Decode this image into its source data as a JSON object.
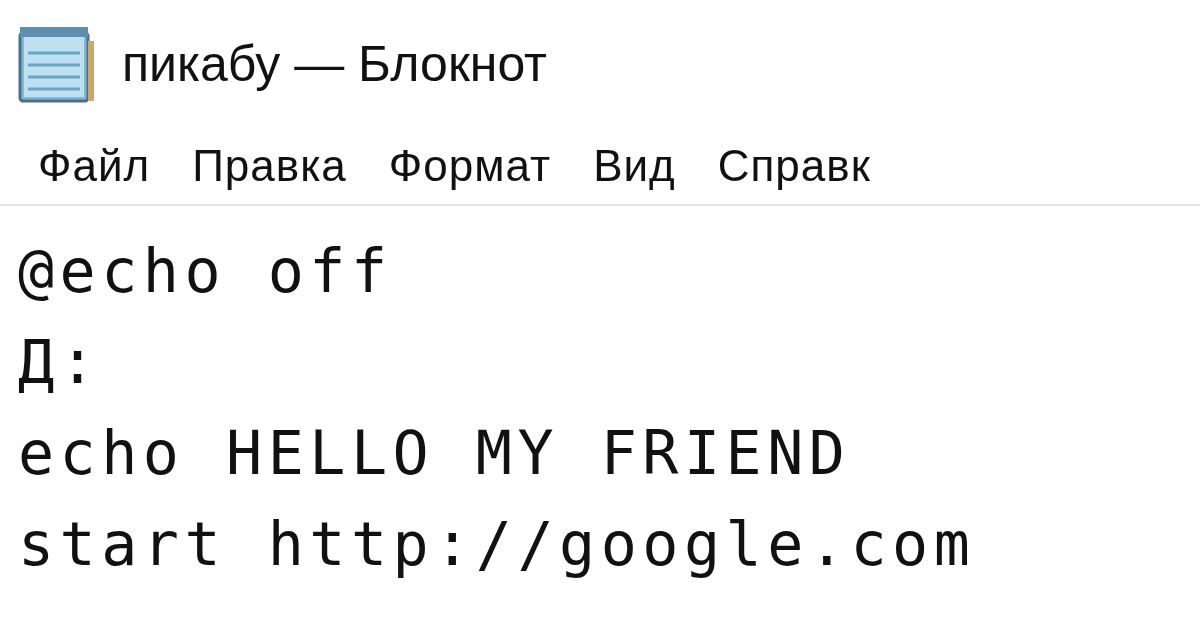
{
  "window": {
    "title": "пикабу — Блокнот"
  },
  "menu": [
    "Файл",
    "Правка",
    "Формат",
    "Вид",
    "Справк"
  ],
  "editor": {
    "lines": [
      "@echo off",
      "Д:",
      "echo HELLO MY FRIEND",
      "start http://google.com"
    ]
  }
}
